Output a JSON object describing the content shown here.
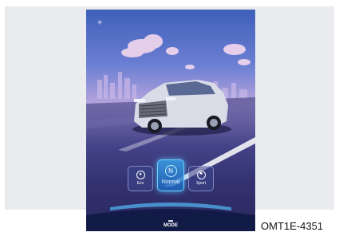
{
  "drive_modes": {
    "eco_label": "Eco",
    "normal_label": "Normal",
    "sport_label": "Sport",
    "selected": "Normal"
  },
  "bottom_tab": {
    "label": "MODE",
    "icon": "car-icon"
  },
  "caption": "OMT1E-4351",
  "colors": {
    "active_glow": "#6fd3ff",
    "sky_top": "#3f5fb9",
    "road_dark": "#14153e"
  }
}
